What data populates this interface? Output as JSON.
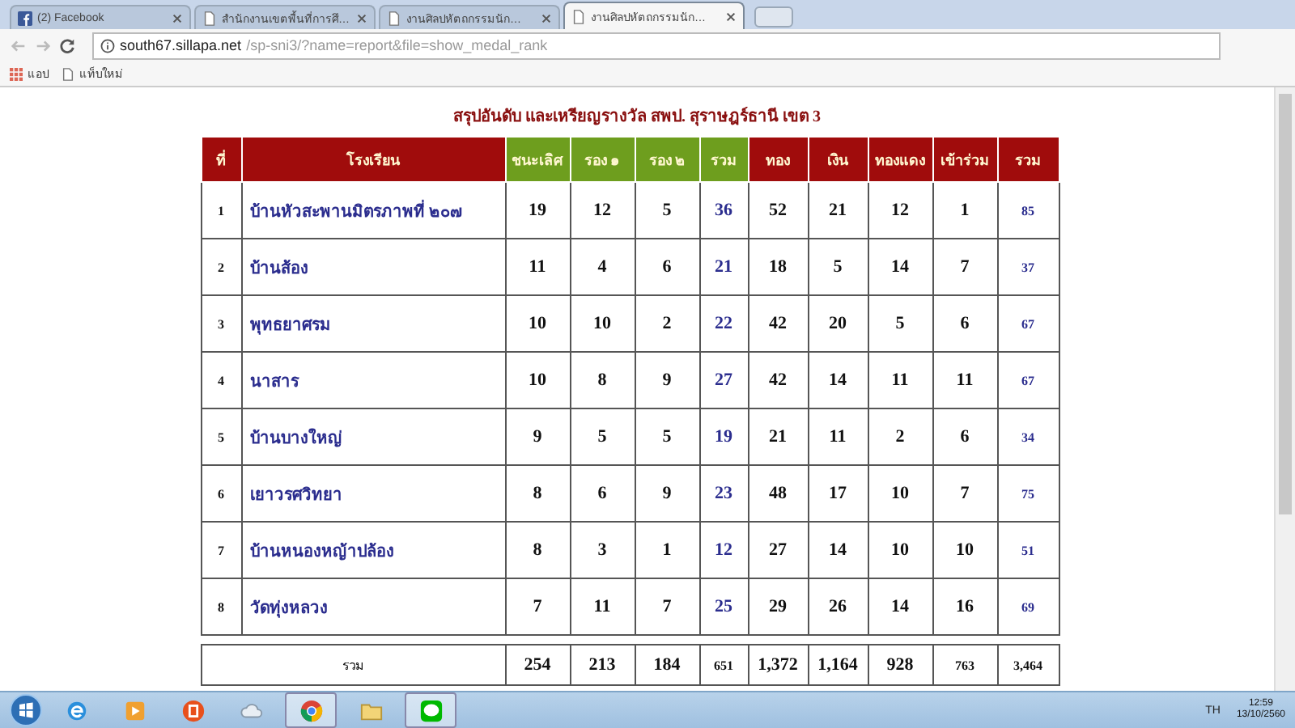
{
  "browser": {
    "tabs": [
      {
        "title": "(2) Facebook",
        "kind": "facebook",
        "selected": false
      },
      {
        "title": "สำนักงานเขตพื้นที่การศึ…",
        "kind": "page",
        "selected": false
      },
      {
        "title": "งานศิลปหัตถกรรมนัก…",
        "kind": "page",
        "selected": false
      },
      {
        "title": "งานศิลปหัตถกรรมนัก…",
        "kind": "page",
        "selected": true
      }
    ],
    "address": {
      "domain": "south67.sillapa.net",
      "path": "/sp-sni3/?name=report&file=show_medal_rank"
    },
    "bookmarks": [
      {
        "label": "แอป",
        "kind": "apps"
      },
      {
        "label": "แท็บใหม่",
        "kind": "page"
      }
    ]
  },
  "report": {
    "title": "สรุปอันดับ และเหรียญรางวัล สพป. สุราษฎร์ธานี เขต 3",
    "columns": [
      {
        "label": "ที่",
        "kind": "index"
      },
      {
        "label": "โรงเรียน",
        "kind": "name"
      },
      {
        "label": "ชนะเลิศ",
        "kind": "placement"
      },
      {
        "label": "รอง ๑",
        "kind": "placement"
      },
      {
        "label": "รอง ๒",
        "kind": "placement"
      },
      {
        "label": "รวม",
        "kind": "placement_total"
      },
      {
        "label": "ทอง",
        "kind": "medal"
      },
      {
        "label": "เงิน",
        "kind": "medal"
      },
      {
        "label": "ทองแดง",
        "kind": "medal"
      },
      {
        "label": "เข้าร่วม",
        "kind": "medal"
      },
      {
        "label": "รวม",
        "kind": "medal_total"
      }
    ],
    "rows": [
      {
        "rank": "1",
        "school": "บ้านหัวสะพานมิตรภาพที่ ๒๐๗",
        "values": [
          "19",
          "12",
          "5",
          "36",
          "52",
          "21",
          "12",
          "1",
          "85"
        ]
      },
      {
        "rank": "2",
        "school": "บ้านส้อง",
        "values": [
          "11",
          "4",
          "6",
          "21",
          "18",
          "5",
          "14",
          "7",
          "37"
        ]
      },
      {
        "rank": "3",
        "school": "พุทธยาศรม",
        "values": [
          "10",
          "10",
          "2",
          "22",
          "42",
          "20",
          "5",
          "6",
          "67"
        ]
      },
      {
        "rank": "4",
        "school": "นาสาร",
        "values": [
          "10",
          "8",
          "9",
          "27",
          "42",
          "14",
          "11",
          "11",
          "67"
        ]
      },
      {
        "rank": "5",
        "school": "บ้านบางใหญ่",
        "values": [
          "9",
          "5",
          "5",
          "19",
          "21",
          "11",
          "2",
          "6",
          "34"
        ]
      },
      {
        "rank": "6",
        "school": "เยาวรศวิทยา",
        "values": [
          "8",
          "6",
          "9",
          "23",
          "48",
          "17",
          "10",
          "7",
          "75"
        ]
      },
      {
        "rank": "7",
        "school": "บ้านหนองหญ้าปล้อง",
        "values": [
          "8",
          "3",
          "1",
          "12",
          "27",
          "14",
          "10",
          "10",
          "51"
        ]
      },
      {
        "rank": "8",
        "school": "วัดทุ่งหลวง",
        "values": [
          "7",
          "11",
          "7",
          "25",
          "29",
          "26",
          "14",
          "16",
          "69"
        ]
      }
    ],
    "totals": {
      "label": "รวม",
      "values": [
        "254",
        "213",
        "184",
        "651",
        "1,372",
        "1,164",
        "928",
        "763",
        "3,464"
      ]
    }
  },
  "taskbar": {
    "apps": [
      {
        "kind": "ie",
        "selected": false
      },
      {
        "kind": "media",
        "selected": false
      },
      {
        "kind": "office",
        "selected": false
      },
      {
        "kind": "cloud",
        "selected": false
      },
      {
        "kind": "chrome",
        "selected": true
      },
      {
        "kind": "folder",
        "selected": false
      },
      {
        "kind": "line",
        "selected": true
      }
    ],
    "language": "TH",
    "time": "12:59",
    "date": "13/10/2560"
  }
}
